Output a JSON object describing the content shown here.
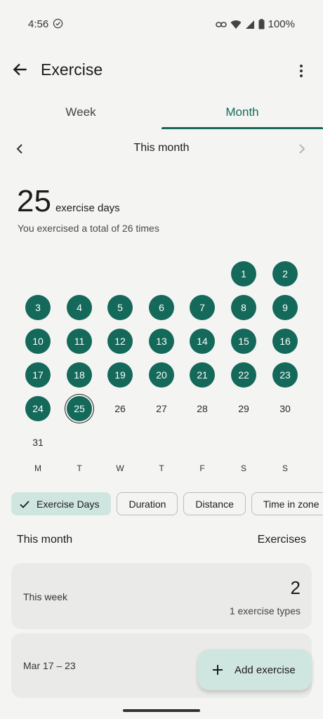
{
  "status_bar": {
    "time": "4:56",
    "battery": "100%"
  },
  "app_bar": {
    "title": "Exercise",
    "back_icon": "arrow-back-icon",
    "menu_icon": "more-vert-icon"
  },
  "tabs": [
    {
      "label": "Week",
      "selected": false
    },
    {
      "label": "Month",
      "selected": true
    }
  ],
  "period": {
    "label": "This month"
  },
  "summary": {
    "count": "25",
    "unit": "exercise days",
    "detail": "You exercised a total of 26 times"
  },
  "calendar": {
    "first_weekday_index": 5,
    "days": [
      "1",
      "2",
      "3",
      "4",
      "5",
      "6",
      "7",
      "8",
      "9",
      "10",
      "11",
      "12",
      "13",
      "14",
      "15",
      "16",
      "17",
      "18",
      "19",
      "20",
      "21",
      "22",
      "23",
      "24",
      "25",
      "26",
      "27",
      "28",
      "29",
      "30",
      "31"
    ],
    "active_through": 25,
    "today": 25,
    "weekdays": [
      "M",
      "T",
      "W",
      "T",
      "F",
      "S",
      "S"
    ]
  },
  "chips": [
    {
      "label": "Exercise Days",
      "selected": true
    },
    {
      "label": "Duration",
      "selected": false
    },
    {
      "label": "Distance",
      "selected": false
    },
    {
      "label": "Time in zone",
      "selected": false
    }
  ],
  "section": {
    "left": "This month",
    "right": "Exercises"
  },
  "cards": [
    {
      "label": "This week",
      "value": "2",
      "sub": "1 exercise types"
    },
    {
      "label": "Mar 17 – 23"
    }
  ],
  "fab": {
    "label": "Add exercise",
    "icon": "plus-icon"
  },
  "colors": {
    "accent": "#14695a",
    "chip_selected": "#cfe5df",
    "background": "#f4f5f2",
    "card": "#eaebe8"
  }
}
